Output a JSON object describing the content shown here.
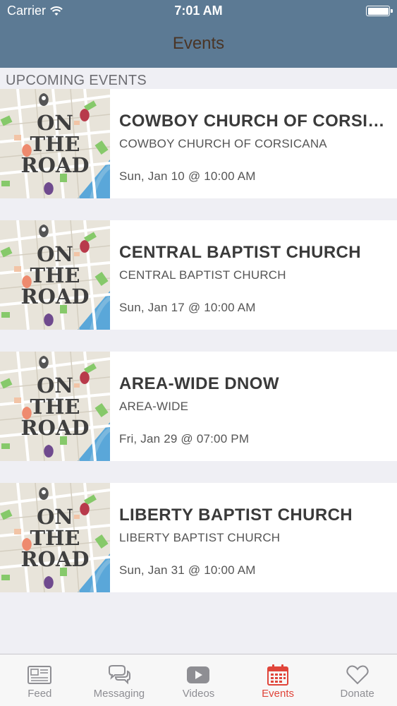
{
  "status_bar": {
    "carrier": "Carrier",
    "time": "7:01 AM"
  },
  "nav": {
    "title": "Events"
  },
  "section": {
    "header": "UPCOMING EVENTS"
  },
  "thumbnail": {
    "lines": [
      "ON",
      "THE",
      "ROAD"
    ]
  },
  "events": [
    {
      "title": "COWBOY CHURCH OF CORSICANA",
      "subtitle": "COWBOY CHURCH OF CORSICANA",
      "date": "Sun, Jan 10 @ 10:00 AM"
    },
    {
      "title": "CENTRAL BAPTIST CHURCH",
      "subtitle": "CENTRAL BAPTIST CHURCH",
      "date": "Sun, Jan 17 @ 10:00 AM"
    },
    {
      "title": "AREA-WIDE DNOW",
      "subtitle": "AREA-WIDE",
      "date": "Fri, Jan 29 @ 07:00 PM"
    },
    {
      "title": "LIBERTY BAPTIST CHURCH",
      "subtitle": "LIBERTY BAPTIST CHURCH",
      "date": "Sun, Jan 31 @ 10:00 AM"
    }
  ],
  "tab_bar": {
    "tabs": [
      {
        "label": "Feed",
        "icon": "newspaper-icon"
      },
      {
        "label": "Messaging",
        "icon": "chat-bubbles-icon"
      },
      {
        "label": "Videos",
        "icon": "play-button-icon"
      },
      {
        "label": "Events",
        "icon": "calendar-icon"
      },
      {
        "label": "Donate",
        "icon": "heart-icon"
      }
    ],
    "active": "Events"
  },
  "colors": {
    "header_bg": "#5c7a94",
    "title_text": "#4a3526",
    "active_tab": "#e0453a",
    "inactive_tab": "#8e8e93",
    "background": "#efeff4"
  }
}
